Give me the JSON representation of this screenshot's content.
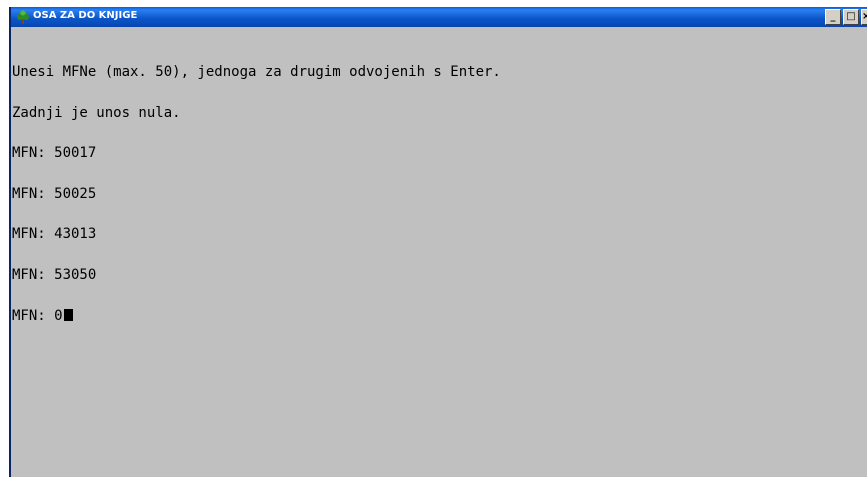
{
  "window": {
    "title": "OSA ZA DO KNJIGE",
    "icon": "tree-icon",
    "buttons": {
      "minimize": "_",
      "maximize": "□",
      "close": "×"
    }
  },
  "console": {
    "lines": [
      "Unesi MFNe (max. 50), jednoga za drugim odvojenih s Enter.",
      "Zadnji je unos nula.",
      "MFN: 50017",
      "MFN: 50025",
      "MFN: 43013",
      "MFN: 53050"
    ],
    "prompt": "MFN: ",
    "input_value": "0"
  },
  "colors": {
    "console_background": "#c0c0c0",
    "console_text": "#000000",
    "titlebar": "#0a54c8"
  }
}
